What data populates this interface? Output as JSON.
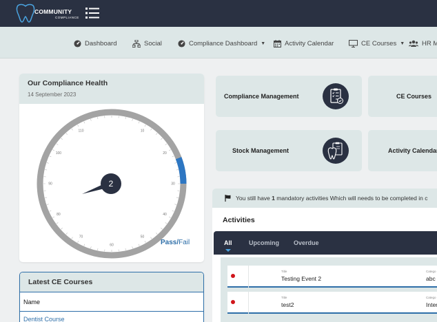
{
  "brand": {
    "script_text": "Dental",
    "name": "COMMUNITY",
    "sub": "COMPLIANCE"
  },
  "colors": {
    "dark": "#2a3142",
    "light_panel": "#dde7e7",
    "accent_blue": "#2d6ea8",
    "alert_red": "#d0151a"
  },
  "nav": [
    {
      "label": "Dashboard",
      "icon": "dashboard-gauge-icon"
    },
    {
      "label": "Social",
      "icon": "network-icon"
    },
    {
      "label": "Compliance Dashboard",
      "icon": "dashboard-gauge-icon",
      "dropdown": true
    },
    {
      "label": "Activity Calendar",
      "icon": "calendar-icon"
    },
    {
      "label": "CE Courses",
      "icon": "monitor-icon",
      "dropdown": true
    },
    {
      "label": "HR Ma",
      "icon": "users-icon"
    }
  ],
  "health": {
    "title": "Our Compliance Health",
    "date": "14 September 2023",
    "value": "2",
    "ticks": [
      "10",
      "20",
      "30",
      "40",
      "50",
      "60",
      "70",
      "80",
      "90",
      "100",
      "110"
    ],
    "blue_arc_fraction_start": 0.92,
    "pass_label": "Pass",
    "slash": "/",
    "fail_label": "Fail"
  },
  "latest_courses": {
    "title": "Latest CE Courses",
    "column": "Name",
    "rows": [
      "Dentist Course"
    ]
  },
  "tiles": [
    {
      "label": "Compliance Management",
      "icon": "clipboard-checklist-icon"
    },
    {
      "label": "CE Courses",
      "icon": ""
    },
    {
      "label": "Stock Management",
      "icon": "tooth-clipboard-icon"
    },
    {
      "label": "Activity Calendar",
      "icon": ""
    }
  ],
  "notice": {
    "prefix": "You still have ",
    "count": "1",
    "suffix": " mandatory activities Which will needs to be completed in c"
  },
  "activities": {
    "title": "Activities",
    "tabs": [
      "All",
      "Upcoming",
      "Overdue"
    ],
    "active_tab": "All",
    "title_label": "Title",
    "category_label": "Catego",
    "items": [
      {
        "title": "Testing Event 2",
        "category": "abc"
      },
      {
        "title": "test2",
        "category": "Inter"
      }
    ]
  }
}
